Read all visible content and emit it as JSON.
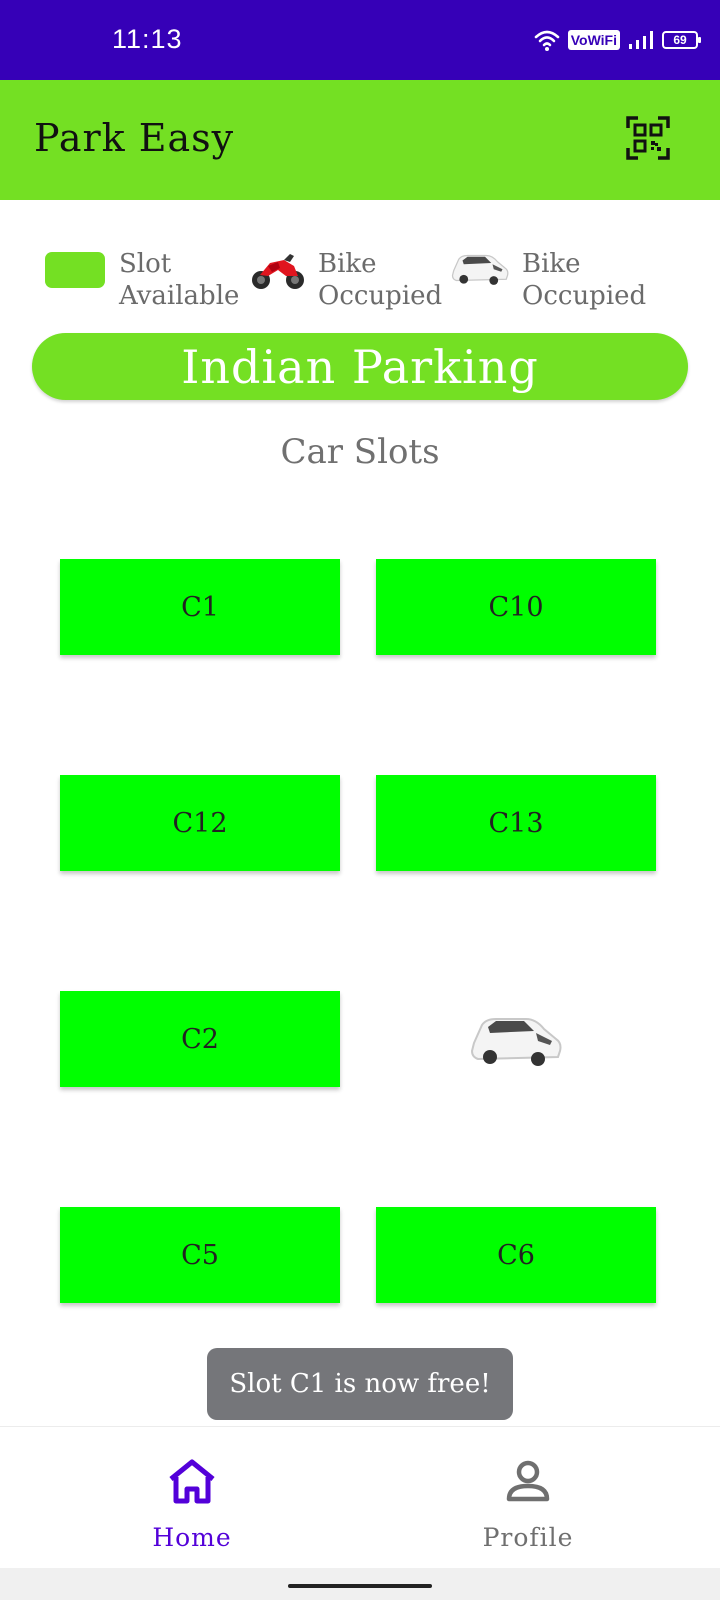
{
  "status_bar": {
    "time": "11:13",
    "network_label": "VoWiFi",
    "battery": "69"
  },
  "app_bar": {
    "title": "Park Easy",
    "action_icon": "qr-code-icon"
  },
  "legend": [
    {
      "label_line1": "Slot",
      "label_line2": "Available",
      "icon": "green-swatch"
    },
    {
      "label_line1": "Bike",
      "label_line2": "Occupied",
      "icon": "motorbike-icon"
    },
    {
      "label_line1": "Bike",
      "label_line2": "Occupied",
      "icon": "car-icon"
    }
  ],
  "banner": {
    "title": "Indian Parking"
  },
  "section": {
    "title": "Car Slots"
  },
  "slots": [
    {
      "label": "C1",
      "status": "available"
    },
    {
      "label": "C10",
      "status": "available"
    },
    {
      "label": "C12",
      "status": "available"
    },
    {
      "label": "C13",
      "status": "available"
    },
    {
      "label": "C2",
      "status": "available"
    },
    {
      "label": "",
      "status": "occupied",
      "icon": "car-icon"
    },
    {
      "label": "C5",
      "status": "available"
    },
    {
      "label": "C6",
      "status": "available"
    }
  ],
  "toast": {
    "message": "Slot C1 is now free!"
  },
  "bottom_nav": {
    "items": [
      {
        "label": "Home",
        "icon": "home-icon",
        "active": true
      },
      {
        "label": "Profile",
        "icon": "person-icon",
        "active": false
      }
    ]
  },
  "colors": {
    "status_bar": "#3600b7",
    "accent_green": "#74e023",
    "slot_green": "#00ff00",
    "nav_active": "#5300d9"
  }
}
